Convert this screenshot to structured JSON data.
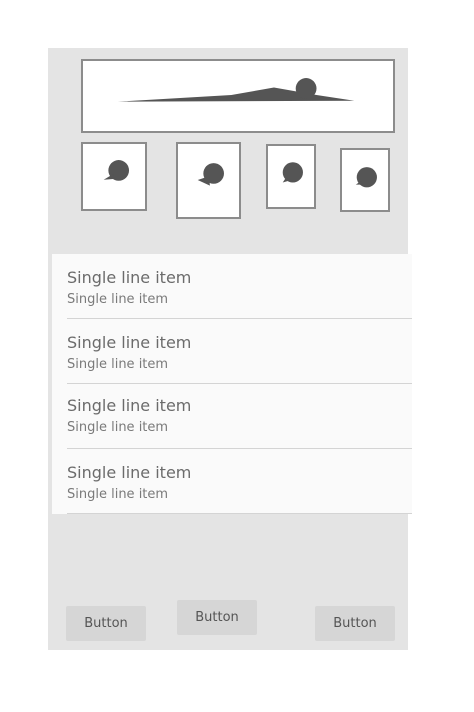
{
  "header_image": {
    "icon": "landscape-image-icon"
  },
  "thumbnails": [
    {
      "icon": "image-placeholder-icon"
    },
    {
      "icon": "image-placeholder-icon"
    },
    {
      "icon": "image-placeholder-icon"
    },
    {
      "icon": "image-placeholder-icon"
    }
  ],
  "list": {
    "items": [
      {
        "primary": "Single line item",
        "secondary": "Single line item"
      },
      {
        "primary": "Single line item",
        "secondary": "Single line item"
      },
      {
        "primary": "Single line item",
        "secondary": "Single line item"
      },
      {
        "primary": "Single line item",
        "secondary": "Single line item"
      }
    ]
  },
  "buttons": [
    {
      "label": "Button"
    },
    {
      "label": "Button"
    },
    {
      "label": "Button"
    }
  ],
  "colors": {
    "screen_background": "#e4e4e4",
    "list_background": "#fafafa",
    "button_background": "#d6d6d6",
    "image_border": "#8c8c8c",
    "icon_fill": "#555555"
  }
}
